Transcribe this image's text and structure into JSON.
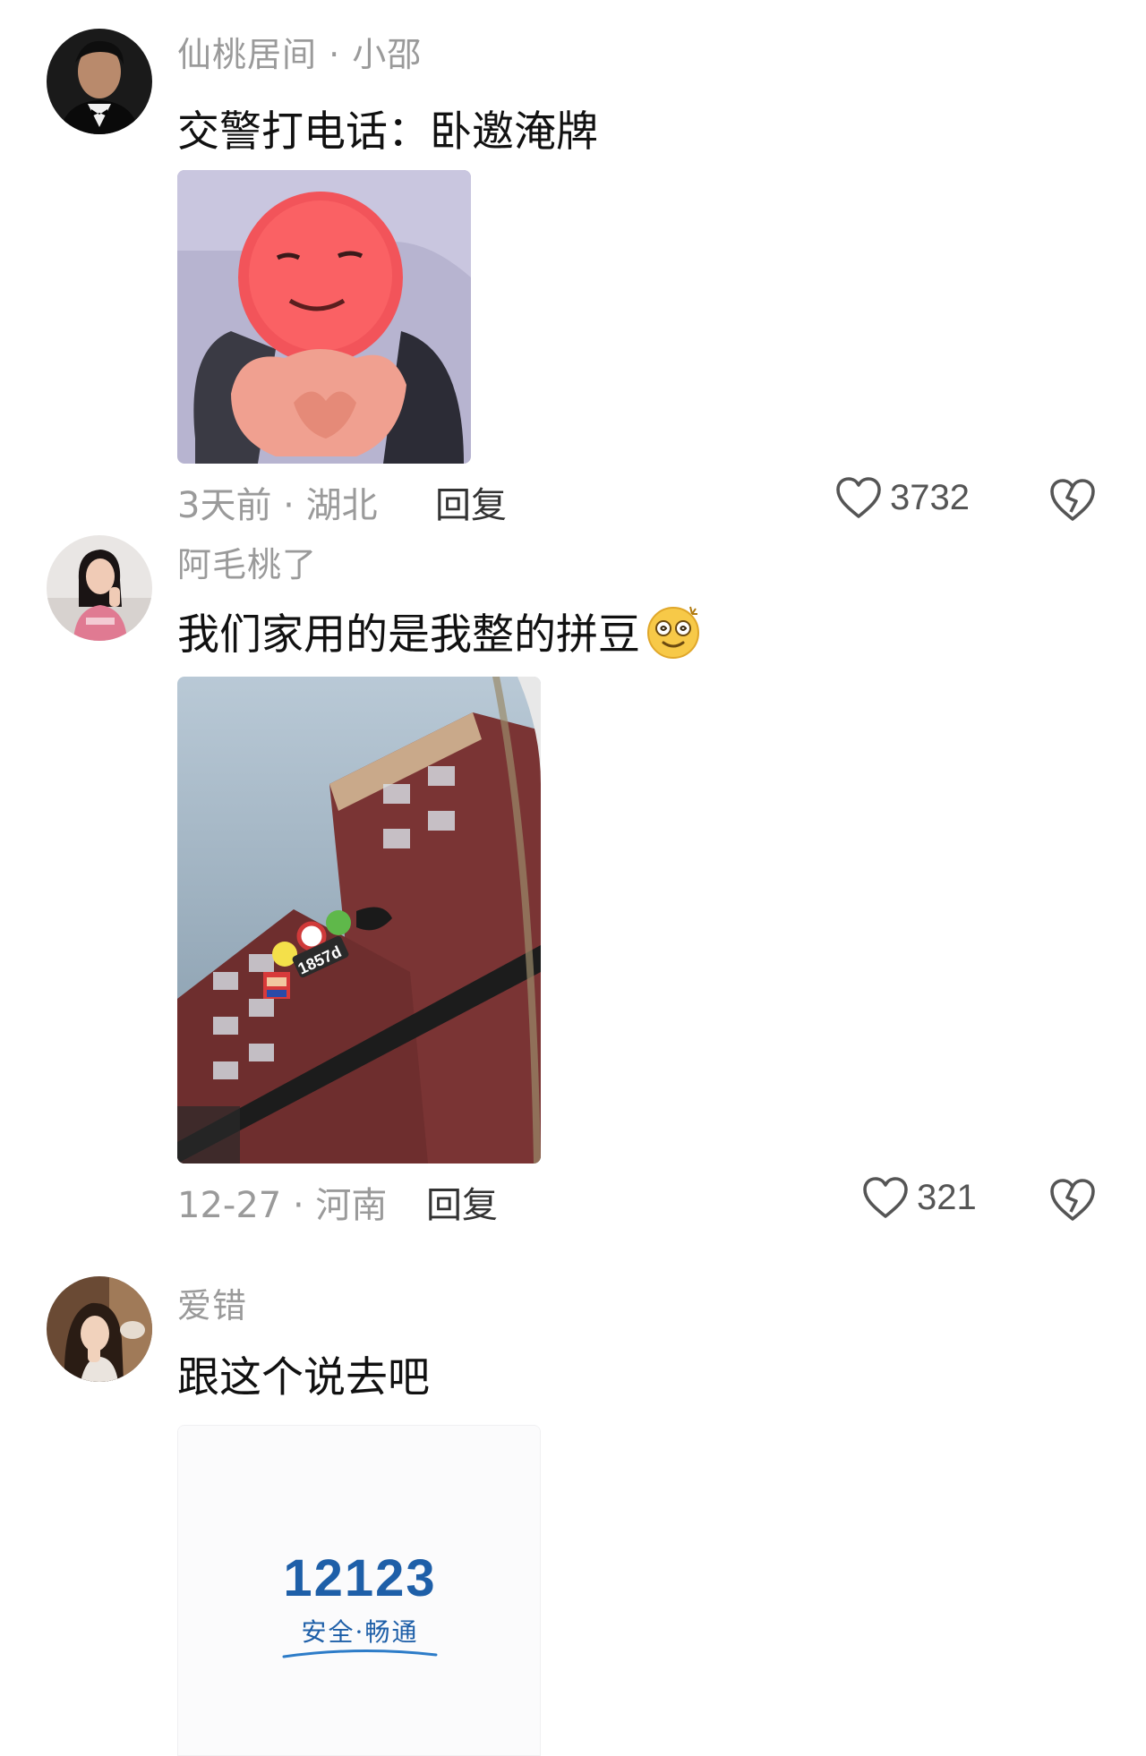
{
  "comments": [
    {
      "username": "仙桃居间 · 小邵",
      "text": "交警打电话：卧邀淹牌",
      "meta": "3天前 · 湖北",
      "reply_label": "回复",
      "likes": "3732",
      "avatar_icon": "man-in-tuxedo-avatar",
      "image_icon": "red-face-meme-sticker"
    },
    {
      "username": "阿毛桃了",
      "text": "我们家用的是我整的拼豆",
      "emoji": "dizzy-smile-emoji",
      "meta": "12-27 · 河南",
      "reply_label": "回复",
      "likes": "321",
      "avatar_icon": "woman-in-pink-avatar",
      "image_icon": "windshield-bead-plate-photo",
      "photo_plate_text": "1857d"
    },
    {
      "username": "爱错",
      "text": "跟这个说去吧",
      "avatar_icon": "girl-selfie-avatar",
      "image_icon": "app-12123-logo",
      "logo": {
        "number": "12123",
        "slogan": "安全·畅通"
      }
    }
  ],
  "colors": {
    "username": "#9a9a9a",
    "text": "#111111",
    "meta": "#9a9a9a",
    "logo_blue": "#1e5fa8"
  }
}
